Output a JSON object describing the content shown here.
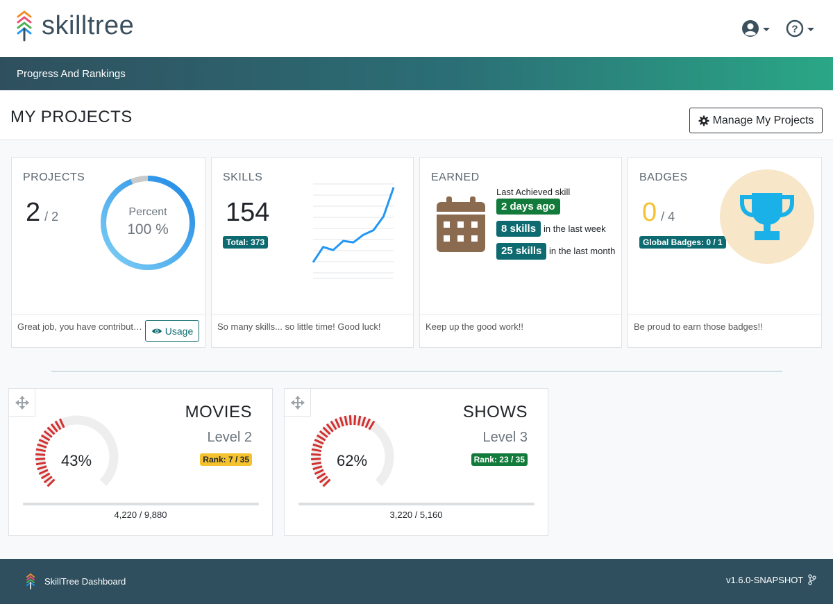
{
  "app": {
    "logo_text": "skilltree"
  },
  "nav": {
    "breadcrumb": "Progress And Rankings"
  },
  "header": {
    "title": "MY PROJECTS",
    "manage_button": "Manage My Projects"
  },
  "cards": {
    "projects": {
      "title": "PROJECTS",
      "count": "2",
      "total": "/ 2",
      "gauge_label": "Percent",
      "gauge_value": "100 %",
      "percent": 100,
      "footer": "Great job, you have contribut…",
      "usage_button": "Usage"
    },
    "skills": {
      "title": "SKILLS",
      "count": "154",
      "total_badge": "Total: 373",
      "footer": "So many skills... so little time! Good luck!",
      "trend": [
        12,
        32,
        28,
        40,
        38,
        48,
        54,
        72,
        110
      ]
    },
    "earned": {
      "title": "EARNED",
      "last_label": "Last Achieved skill",
      "last_badge": "2 days ago",
      "week_badge": "8 skills",
      "week_text": "in the last week",
      "month_badge": "25 skills",
      "month_text": "in the last month",
      "footer": "Keep up the good work!!"
    },
    "badges": {
      "title": "BADGES",
      "count": "0",
      "total": "/ 4",
      "global_badge": "Global Badges: 0 / 1",
      "footer": "Be proud to earn those badges!!"
    }
  },
  "projects": [
    {
      "name": "MOVIES",
      "level": "Level 2",
      "rank": "Rank: 7 / 35",
      "rank_color": "#f5c22f",
      "percent_text": "43%",
      "percent": 43,
      "points": "4,220 / 9,880"
    },
    {
      "name": "SHOWS",
      "level": "Level 3",
      "rank": "Rank: 23 / 35",
      "rank_color": "#127a3a",
      "percent_text": "62%",
      "percent": 62,
      "points": "3,220 / 5,160"
    }
  ],
  "footer": {
    "title": "SkillTree Dashboard",
    "version": "v1.6.0-SNAPSHOT"
  },
  "colors": {
    "accent": "#1e88e5",
    "trophy": "#1ab1e8",
    "brown": "#8b6b4f",
    "gauge_red": "#d32f2f"
  }
}
